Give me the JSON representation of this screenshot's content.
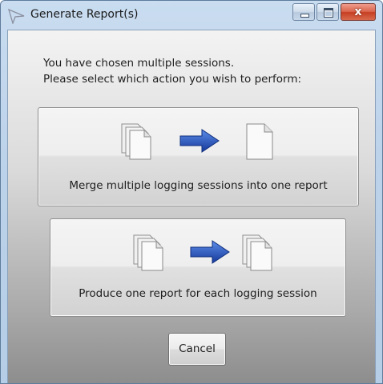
{
  "window": {
    "title": "Generate Report(s)",
    "close_glyph": "x"
  },
  "prompt": {
    "line1": "You have chosen multiple sessions.",
    "line2": "Please select which action you wish to perform:"
  },
  "actions": [
    {
      "label": "Merge multiple logging sessions into one report",
      "icons": [
        "multiple-documents-icon",
        "right-arrow-icon",
        "single-document-icon"
      ]
    },
    {
      "label": "Produce one report for each logging session",
      "icons": [
        "multiple-documents-icon",
        "right-arrow-icon",
        "multiple-documents-icon"
      ]
    }
  ],
  "cancel_label": "Cancel",
  "colors": {
    "arrow": "#1f4fb8",
    "close_button": "#c63e22",
    "titlebar": "#c9dcf0"
  }
}
